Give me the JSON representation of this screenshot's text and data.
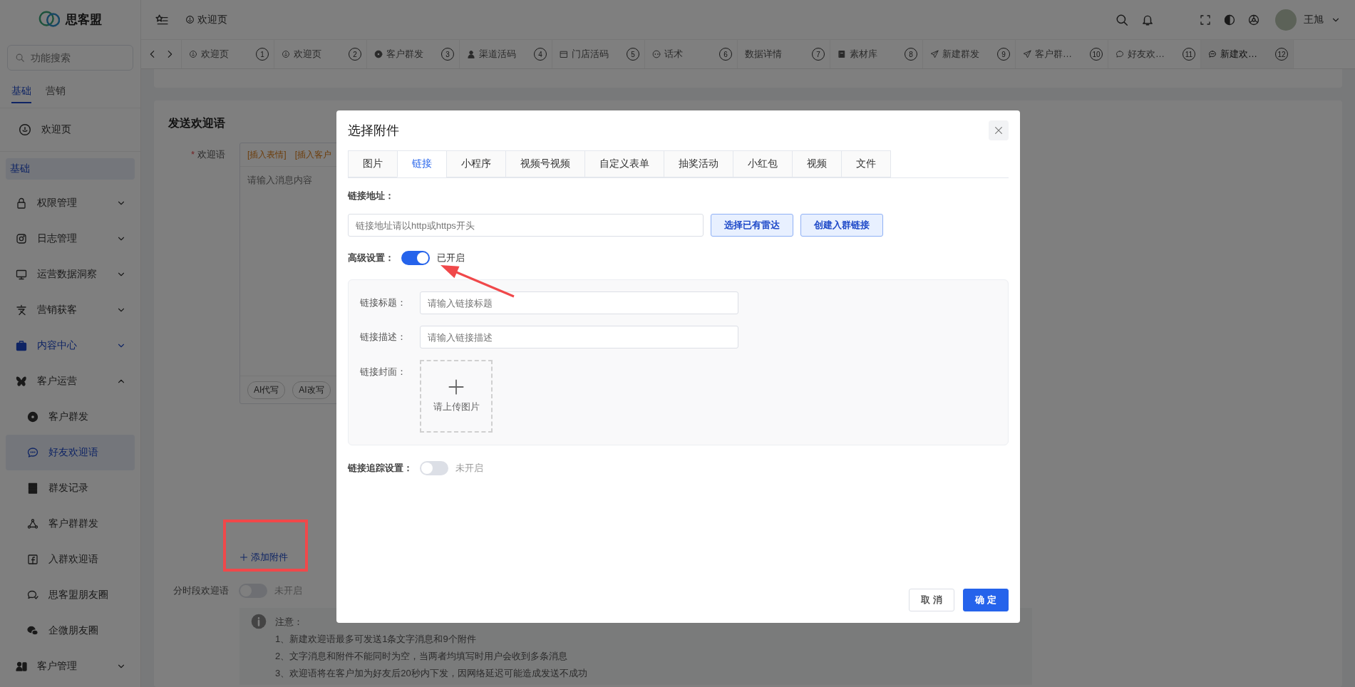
{
  "app": {
    "name": "思客盟"
  },
  "search": {
    "placeholder": "功能搜索"
  },
  "sidebar_tabs": [
    {
      "label": "基础",
      "selected": true
    },
    {
      "label": "营销",
      "selected": false
    }
  ],
  "sidebar": {
    "home": "欢迎页",
    "section": "基础",
    "items": [
      {
        "label": "权限管理",
        "expanded": false,
        "selected": false
      },
      {
        "label": "日志管理",
        "expanded": false,
        "selected": false
      },
      {
        "label": "运营数据洞察",
        "expanded": false,
        "selected": false
      },
      {
        "label": "营销获客",
        "expanded": false,
        "selected": false
      },
      {
        "label": "内容中心",
        "expanded": false,
        "selected": true
      },
      {
        "label": "客户运营",
        "expanded": true,
        "selected": false,
        "children": [
          {
            "label": "客户群发",
            "selected": false
          },
          {
            "label": "好友欢迎语",
            "selected": true
          },
          {
            "label": "群发记录",
            "selected": false
          },
          {
            "label": "客户群群发",
            "selected": false
          },
          {
            "label": "入群欢迎语",
            "selected": false
          },
          {
            "label": "思客盟朋友圈",
            "selected": false
          },
          {
            "label": "企微朋友圈",
            "selected": false
          }
        ]
      },
      {
        "label": "客户管理",
        "expanded": false,
        "selected": false
      }
    ]
  },
  "header": {
    "breadcrumb": "欢迎页",
    "user": "王旭"
  },
  "page_tabs": [
    {
      "label": "欢迎页",
      "index": "1",
      "selected": false
    },
    {
      "label": "欢迎页",
      "index": "2",
      "selected": false
    },
    {
      "label": "客户群发",
      "index": "3",
      "selected": false
    },
    {
      "label": "渠道活码",
      "index": "4",
      "selected": false
    },
    {
      "label": "门店活码",
      "index": "5",
      "selected": false
    },
    {
      "label": "话术",
      "index": "6",
      "selected": false
    },
    {
      "label": "数据详情",
      "index": "7",
      "selected": false
    },
    {
      "label": "素材库",
      "index": "8",
      "selected": false
    },
    {
      "label": "新建群发",
      "index": "9",
      "selected": false
    },
    {
      "label": "客户群…",
      "index": "10",
      "selected": false
    },
    {
      "label": "好友欢…",
      "index": "11",
      "selected": false
    },
    {
      "label": "新建欢…",
      "index": "12",
      "selected": true
    }
  ],
  "form": {
    "title": "发送欢迎语",
    "label": "欢迎语",
    "required_mark": "*",
    "insert_links": [
      "[插入表情]",
      "[插入客户"
    ],
    "placeholder": "请输入消息内容",
    "ai_buttons": [
      "AI代写",
      "AI改写"
    ],
    "add_attachment": "添加附件",
    "timed": {
      "label": "分时段欢迎语",
      "on": false,
      "status": "未开启"
    },
    "notice": {
      "title": "注意：",
      "lines": [
        "1、新建欢迎语最多可发送1条文字消息和9个附件",
        "2、文字消息和附件不能同时为空，当两者均填写时用户会收到多条消息",
        "3、欢迎语将在客户加为好友后20秒内下发，因网络延迟可能造成发送不成功"
      ]
    }
  },
  "modal": {
    "title": "选择附件",
    "tabs": [
      {
        "label": "图片",
        "selected": false
      },
      {
        "label": "链接",
        "selected": true
      },
      {
        "label": "小程序",
        "selected": false
      },
      {
        "label": "视频号视频",
        "selected": false
      },
      {
        "label": "自定义表单",
        "selected": false
      },
      {
        "label": "抽奖活动",
        "selected": false
      },
      {
        "label": "小红包",
        "selected": false
      },
      {
        "label": "视频",
        "selected": false
      },
      {
        "label": "文件",
        "selected": false
      }
    ],
    "url_label": "链接地址：",
    "url_field": {
      "placeholder": "链接地址请以http或https开头"
    },
    "url_buttons": [
      "选择已有雷达",
      "创建入群链接"
    ],
    "advanced": {
      "label": "高级设置：",
      "on": true,
      "status": "已开启"
    },
    "fields": [
      {
        "label": "链接标题：",
        "placeholder": "请输入链接标题"
      },
      {
        "label": "链接描述：",
        "placeholder": "请输入链接描述"
      }
    ],
    "cover": {
      "label": "链接封面：",
      "hint": "请上传图片"
    },
    "tracking": {
      "label": "链接追踪设置：",
      "on": false,
      "status": "未开启"
    },
    "buttons": [
      {
        "label": "取 消",
        "kind": "secondary"
      },
      {
        "label": "确 定",
        "kind": "primary"
      }
    ]
  }
}
